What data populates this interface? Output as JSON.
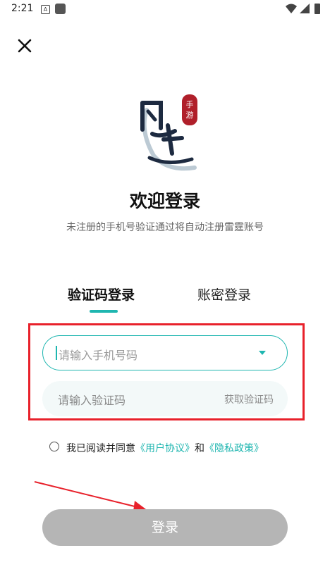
{
  "status_bar": {
    "time": "2:21",
    "icon_a": "A"
  },
  "header": {
    "close_icon": "close-icon"
  },
  "logo": {
    "badge_text": "手游",
    "calligraphy": "问道"
  },
  "main": {
    "title": "欢迎登录",
    "subtitle": "未注册的手机号验证通过将自动注册雷霆账号"
  },
  "tabs": [
    {
      "label": "验证码登录",
      "active": true
    },
    {
      "label": "账密登录",
      "active": false
    }
  ],
  "form": {
    "phone_placeholder": "请输入手机号码",
    "code_placeholder": "请输入验证码",
    "get_code_label": "获取验证码"
  },
  "agreement": {
    "prefix": "我已阅读并同意",
    "user_agreement": "《用户协议》",
    "and": "和",
    "privacy_policy": "《隐私政策》",
    "checked": false
  },
  "login_button": {
    "label": "登录"
  },
  "colors": {
    "accent": "#1fb6b0",
    "annotation_red": "#e8212b",
    "button_disabled": "#b5b5b5"
  }
}
